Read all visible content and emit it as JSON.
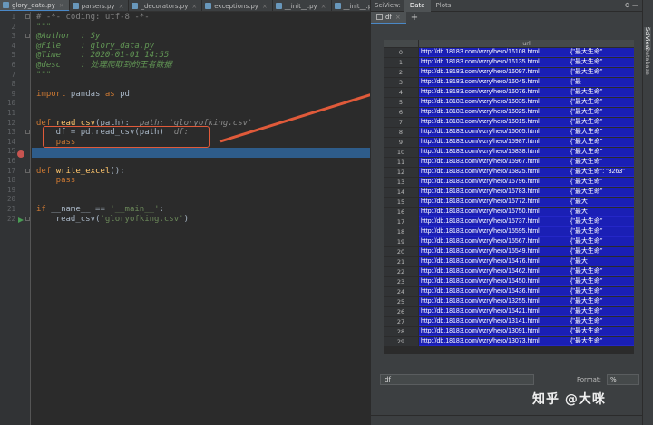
{
  "editor": {
    "tabs": [
      {
        "label": "glory_data.py",
        "active": true
      },
      {
        "label": "parsers.py",
        "active": false
      },
      {
        "label": "_decorators.py",
        "active": false
      },
      {
        "label": "exceptions.py",
        "active": false
      },
      {
        "label": "__init__.py",
        "active": false
      },
      {
        "label": "__init__.py",
        "active": false
      }
    ],
    "line_numbers": [
      "1",
      "2",
      "3",
      "4",
      "5",
      "6",
      "7",
      "8",
      "9",
      "10",
      "11",
      "12",
      "13",
      "14",
      "15",
      "16",
      "17",
      "18",
      "19",
      "20",
      "21",
      "22"
    ],
    "lines": {
      "l1": "# -*- coding: utf-8 -*-",
      "l2": "\"\"\"",
      "l3": "@Author  : Sy",
      "l4": "@File    : glory_data.py",
      "l5": "@Time    : 2020-01-01 14:55",
      "l6": "@desc    : 处理爬取到的王者数据",
      "l7": "\"\"\"",
      "l9_kw": "import",
      "l9_mod": " pandas ",
      "l9_as": "as",
      "l9_alias": " pd",
      "l12_def": "def",
      "l12_name": "read_csv",
      "l12_args": "(path):",
      "l12_hint": "  path: 'gloryofking.csv'",
      "l13_code": "    df = pd.read_csv(path)",
      "l13_hint": "  df:",
      "l14_kw": "    pass",
      "l17_def": "def",
      "l17_name": "write_excel",
      "l17_args": "():",
      "l18_kw": "    pass",
      "l21_if": "if",
      "l21_cond": " __name__ == ",
      "l21_str": "'__main__'",
      "l21_colon": ":",
      "l22_call": "    read_csv(",
      "l22_str": "'gloryofking.csv'",
      "l22_close": ")"
    }
  },
  "sciview": {
    "title": "SciView:",
    "tabs": [
      "Data",
      "Plots"
    ],
    "df_tab": "df",
    "add_tab": "+",
    "column_header": "url",
    "rows": [
      {
        "i": "0",
        "url": "http://db.18183.com/wzry/hero/16108.html",
        "extra": "{\"最大生命\""
      },
      {
        "i": "1",
        "url": "http://db.18183.com/wzry/hero/16135.html",
        "extra": "{\"最大生命\""
      },
      {
        "i": "2",
        "url": "http://db.18183.com/wzry/hero/16097.html",
        "extra": "{\"最大生命\""
      },
      {
        "i": "3",
        "url": "http://db.18183.com/wzry/hero/16045.html",
        "extra": "{\"最"
      },
      {
        "i": "4",
        "url": "http://db.18183.com/wzry/hero/16076.html",
        "extra": "{\"最大生命\""
      },
      {
        "i": "5",
        "url": "http://db.18183.com/wzry/hero/16035.html",
        "extra": "{\"最大生命\""
      },
      {
        "i": "6",
        "url": "http://db.18183.com/wzry/hero/16025.html",
        "extra": "{\"最大生命\""
      },
      {
        "i": "7",
        "url": "http://db.18183.com/wzry/hero/16015.html",
        "extra": "{\"最大生命\""
      },
      {
        "i": "8",
        "url": "http://db.18183.com/wzry/hero/16005.html",
        "extra": "{\"最大生命\""
      },
      {
        "i": "9",
        "url": "http://db.18183.com/wzry/hero/15987.html",
        "extra": "{\"最大生命\""
      },
      {
        "i": "10",
        "url": "http://db.18183.com/wzry/hero/15838.html",
        "extra": "{\"最大生命\""
      },
      {
        "i": "11",
        "url": "http://db.18183.com/wzry/hero/15967.html",
        "extra": "{\"最大生命\""
      },
      {
        "i": "12",
        "url": "http://db.18183.com/wzry/hero/15825.html",
        "extra": "{\"最大生命\": \"3263\""
      },
      {
        "i": "13",
        "url": "http://db.18183.com/wzry/hero/15796.html",
        "extra": "{\"最大生命\""
      },
      {
        "i": "14",
        "url": "http://db.18183.com/wzry/hero/15783.html",
        "extra": "{\"最大生命\""
      },
      {
        "i": "15",
        "url": "http://db.18183.com/wzry/hero/15772.html",
        "extra": "{\"最大"
      },
      {
        "i": "16",
        "url": "http://db.18183.com/wzry/hero/15750.html",
        "extra": "{\"最大"
      },
      {
        "i": "17",
        "url": "http://db.18183.com/wzry/hero/15737.html",
        "extra": "{\"最大生命\""
      },
      {
        "i": "18",
        "url": "http://db.18183.com/wzry/hero/15595.html",
        "extra": "{\"最大生命\""
      },
      {
        "i": "19",
        "url": "http://db.18183.com/wzry/hero/15567.html",
        "extra": "{\"最大生命\""
      },
      {
        "i": "20",
        "url": "http://db.18183.com/wzry/hero/15549.html",
        "extra": "{\"最大生命\""
      },
      {
        "i": "21",
        "url": "http://db.18183.com/wzry/hero/15476.html",
        "extra": "{\"最大"
      },
      {
        "i": "22",
        "url": "http://db.18183.com/wzry/hero/15462.html",
        "extra": "{\"最大生命\""
      },
      {
        "i": "23",
        "url": "http://db.18183.com/wzry/hero/15450.html",
        "extra": "{\"最大生命\""
      },
      {
        "i": "24",
        "url": "http://db.18183.com/wzry/hero/15436.html",
        "extra": "{\"最大生命\""
      },
      {
        "i": "25",
        "url": "http://db.18183.com/wzry/hero/13255.html",
        "extra": "{\"最大生命\""
      },
      {
        "i": "26",
        "url": "http://db.18183.com/wzry/hero/15421.html",
        "extra": "{\"最大生命\""
      },
      {
        "i": "27",
        "url": "http://db.18183.com/wzry/hero/13141.html",
        "extra": "{\"最大生命\""
      },
      {
        "i": "28",
        "url": "http://db.18183.com/wzry/hero/13091.html",
        "extra": "{\"最大生命\""
      },
      {
        "i": "29",
        "url": "http://db.18183.com/wzry/hero/13073.html",
        "extra": "{\"最大生命\""
      }
    ],
    "expression_value": "df",
    "format_label": "Format:",
    "format_value": "%",
    "watermark": "知乎 @大咪",
    "side_tabs": [
      "SciView",
      "Database"
    ]
  },
  "colors": {
    "selection_blue": "#1a1fb5",
    "annotation_red": "#e05a3a",
    "exec_line": "#2e5c8a",
    "breakpoint": "#c75450"
  }
}
